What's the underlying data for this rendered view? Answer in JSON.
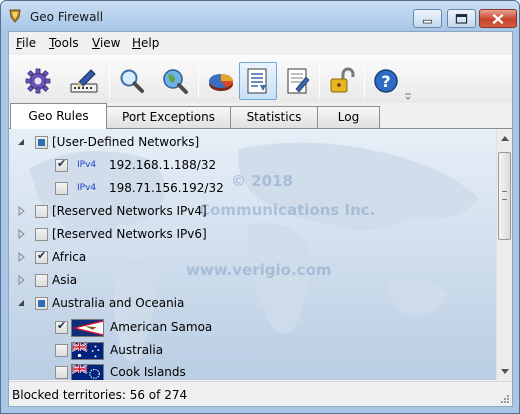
{
  "window": {
    "title": "Geo Firewall"
  },
  "menu": [
    {
      "label": "File"
    },
    {
      "label": "Tools"
    },
    {
      "label": "View"
    },
    {
      "label": "Help"
    }
  ],
  "toolbar": {
    "buttons": [
      {
        "icon": "gear-icon"
      },
      {
        "icon": "edit-network-icon"
      },
      {
        "icon": "magnifier-icon"
      },
      {
        "icon": "globe-search-icon"
      },
      {
        "icon": "pie-chart-icon"
      },
      {
        "icon": "list-view-icon",
        "active": true
      },
      {
        "icon": "document-edit-icon"
      },
      {
        "icon": "padlock-open-icon"
      },
      {
        "icon": "help-icon"
      }
    ]
  },
  "tabs": [
    {
      "label": "Geo Rules",
      "selected": true
    },
    {
      "label": "Port Exceptions"
    },
    {
      "label": "Statistics"
    },
    {
      "label": "Log"
    }
  ],
  "watermark": {
    "line1": "© 2018",
    "line2": "Communications Inc.",
    "line3": "www.verigio.com"
  },
  "tree": [
    {
      "label": "[User-Defined Networks]",
      "state": "partial",
      "expanded": true
    },
    {
      "tag": "IPv4",
      "label": "192.168.1.188/32",
      "state": "checked"
    },
    {
      "tag": "IPv4",
      "label": "198.71.156.192/32",
      "state": "unchecked"
    },
    {
      "label": "[Reserved Networks IPv4]",
      "state": "unchecked"
    },
    {
      "label": "[Reserved Networks IPv6]",
      "state": "unchecked"
    },
    {
      "label": "Africa",
      "state": "checked"
    },
    {
      "label": "Asia",
      "state": "unchecked"
    },
    {
      "label": "Australia and Oceania",
      "state": "partial",
      "expanded": true
    },
    {
      "label": "American Samoa",
      "state": "checked",
      "flag": "american-samoa-flag"
    },
    {
      "label": "Australia",
      "state": "unchecked",
      "flag": "australia-flag"
    },
    {
      "label": "Cook Islands",
      "state": "unchecked",
      "flag": "cook-islands-flag"
    }
  ],
  "status": {
    "text": "Blocked territories: 56 of 274"
  },
  "colors": {
    "titlebar": "#b7d1ee",
    "accent": "#2e6fb6",
    "ipv_tag": "#1f43c7",
    "close": "#c7432b"
  }
}
